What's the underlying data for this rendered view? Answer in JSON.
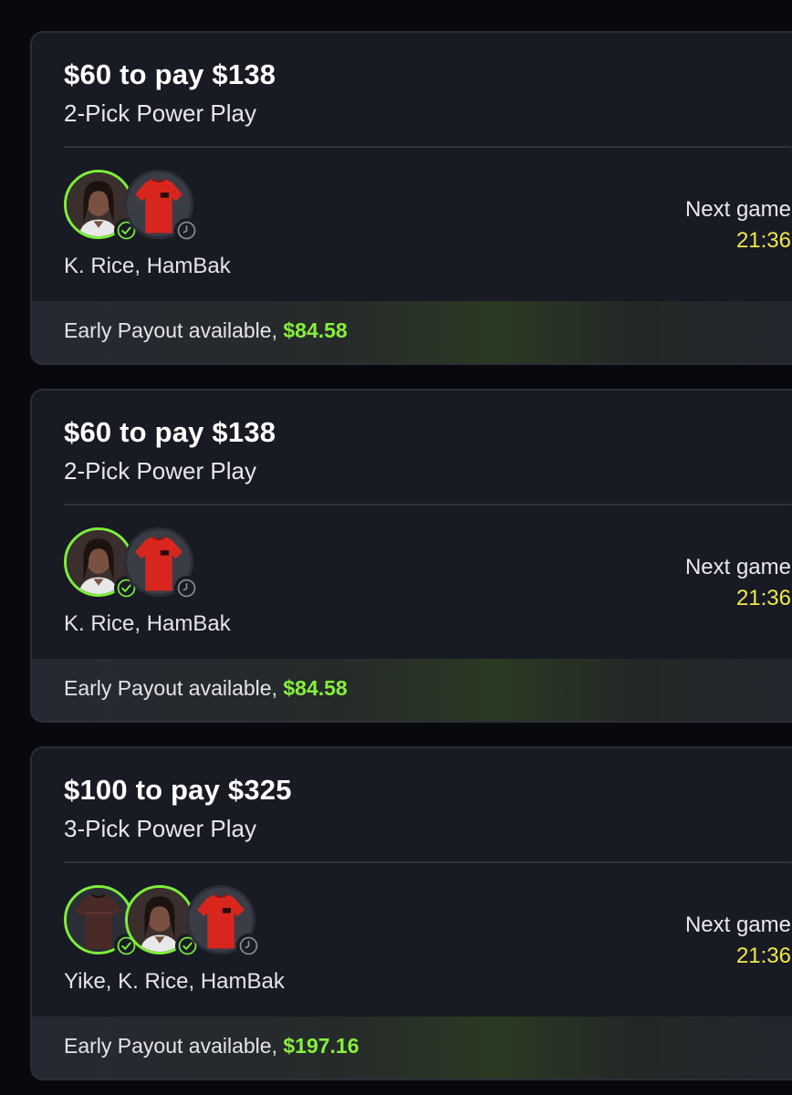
{
  "cards": [
    {
      "title": "$60 to pay $138",
      "subtitle": "2-Pick Power Play",
      "avatars": [
        {
          "icon": "player-photo-icon",
          "status": "check-icon"
        },
        {
          "icon": "red-jersey-icon",
          "status": "clock-icon"
        }
      ],
      "names": "K. Rice, HamBak",
      "next_label": "Next game",
      "next_time": "21:36",
      "payout_label": "Early Payout available, ",
      "payout_amount": "$84.58"
    },
    {
      "title": "$60 to pay $138",
      "subtitle": "2-Pick Power Play",
      "avatars": [
        {
          "icon": "player-photo-icon",
          "status": "check-icon"
        },
        {
          "icon": "red-jersey-icon",
          "status": "clock-icon"
        }
      ],
      "names": "K. Rice, HamBak",
      "next_label": "Next game",
      "next_time": "21:36",
      "payout_label": "Early Payout available, ",
      "payout_amount": "$84.58"
    },
    {
      "title": "$100 to pay $325",
      "subtitle": "3-Pick Power Play",
      "avatars": [
        {
          "icon": "dark-jersey-icon",
          "status": "check-icon"
        },
        {
          "icon": "player-photo-icon",
          "status": "check-icon"
        },
        {
          "icon": "red-jersey-icon",
          "status": "clock-icon"
        }
      ],
      "names": "Yike, K. Rice, HamBak",
      "next_label": "Next game",
      "next_time": "21:36",
      "payout_label": "Early Payout available, ",
      "payout_amount": "$197.16"
    }
  ],
  "colors": {
    "background": "#08090f",
    "card": "#181a24",
    "accent_green": "#86f03c",
    "time_yellow": "#f0e84a"
  }
}
